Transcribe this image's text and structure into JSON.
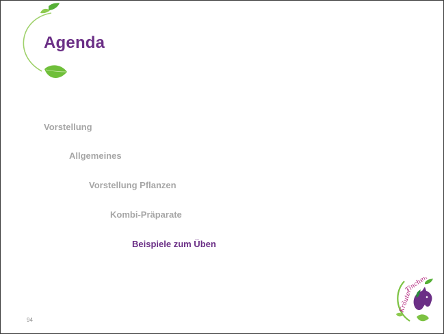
{
  "slide": {
    "title": "Agenda",
    "page_number": "94",
    "agenda": [
      {
        "label": "Vorstellung",
        "active": false
      },
      {
        "label": "Allgemeines",
        "active": false
      },
      {
        "label": "Vorstellung Pflanzen",
        "active": false
      },
      {
        "label": "Kombi-Präparate",
        "active": false
      },
      {
        "label": "Beispiele zum Üben",
        "active": true
      }
    ],
    "logo": {
      "text_part1": "Kräuter",
      "text_part2": "Tinchen"
    }
  },
  "colors": {
    "accent": "#6b2f86",
    "inactive_text": "#a6a6a6",
    "leaf_green": "#7cc242",
    "logo_magenta": "#b0207a"
  },
  "icons": [
    "leaf-vine-icon",
    "horse-logo-icon"
  ]
}
